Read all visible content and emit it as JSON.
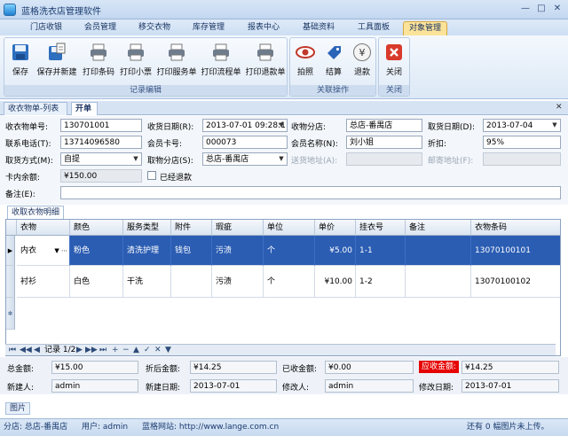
{
  "app": {
    "title": "蓝格洗衣店管理软件"
  },
  "menu_tabs": [
    "门店收银",
    "会员管理",
    "移交衣物",
    "库存管理",
    "报表中心",
    "基础资料",
    "工具面板",
    "对象管理"
  ],
  "ribbon": {
    "edit_buttons": [
      "保存",
      "保存并新建",
      "打印条码",
      "打印小票",
      "打印服务单",
      "打印流程单",
      "打印退款单"
    ],
    "edit_group": "记录编辑",
    "related_buttons": [
      "拍照",
      "结算",
      "退款"
    ],
    "related_group": "关联操作",
    "close_button": "关闭",
    "close_group": "关闭"
  },
  "doc_tabs": [
    "收衣物单-列表",
    "开单"
  ],
  "form": {
    "order_no_label": "收衣物单号:",
    "order_no": "130701001",
    "receive_date_label": "收货日期(R):",
    "receive_date": "2013-07-01 09:28:1",
    "receive_branch_label": "收物分店:",
    "receive_branch": "总店-番禺店",
    "pickup_date_label": "取货日期(D):",
    "pickup_date": "2013-07-04",
    "phone_label": "联系电话(T):",
    "phone": "13714096580",
    "member_card_label": "会员卡号:",
    "member_card": "000073",
    "member_name_label": "会员名称(N):",
    "member_name": "刘小姐",
    "discount_label": "折扣:",
    "discount": "95%",
    "pickup_method_label": "取货方式(M):",
    "pickup_method": "自提",
    "pickup_branch_label": "取物分店(S):",
    "pickup_branch": "总店-番禺店",
    "delivery_addr_label": "送货地址(A):",
    "mail_addr_label": "邮寄地址(F):",
    "card_balance_label": "卡内余额:",
    "card_balance": "¥150.00",
    "refunded_label": "已经退款",
    "remark_label": "备注(E):"
  },
  "grid": {
    "tab": "收取衣物明细",
    "columns": [
      "衣物",
      "颜色",
      "服务类型",
      "附件",
      "瑕疵",
      "单位",
      "单价",
      "挂衣号",
      "备注",
      "衣物条码"
    ],
    "rows": [
      [
        "内衣",
        "粉色",
        "清洗护理",
        "钱包",
        "污渍",
        "个",
        "¥5.00",
        "1-1",
        "",
        "13070100101"
      ],
      [
        "衬衫",
        "白色",
        "干洗",
        "",
        "污渍",
        "个",
        "¥10.00",
        "1-2",
        "",
        "13070100102"
      ]
    ],
    "record_nav": "记录 1/2"
  },
  "summary": {
    "total_label": "总金额:",
    "total": "¥15.00",
    "after_discount_label": "折后金额:",
    "after_discount": "¥14.25",
    "received_label": "已收金额:",
    "received": "¥0.00",
    "due_label": "应收金额:",
    "due": "¥14.25",
    "creator_label": "新建人:",
    "creator": "admin",
    "created_label": "新建日期:",
    "created": "2013-07-01",
    "modifier_label": "修改人:",
    "modifier": "admin",
    "modified_label": "修改日期:",
    "modified": "2013-07-01"
  },
  "picture_tab": "图片",
  "status": {
    "branch": "分店: 总店-番禺店",
    "user": "用户: admin",
    "site": "蓝格网站: http://www.lange.com.cn",
    "pictures": "还有 0 幅图片未上传。"
  },
  "colors": {
    "accent": "#2b5db3",
    "due_bg": "#e60000",
    "active_tab": "#fbe39a"
  }
}
